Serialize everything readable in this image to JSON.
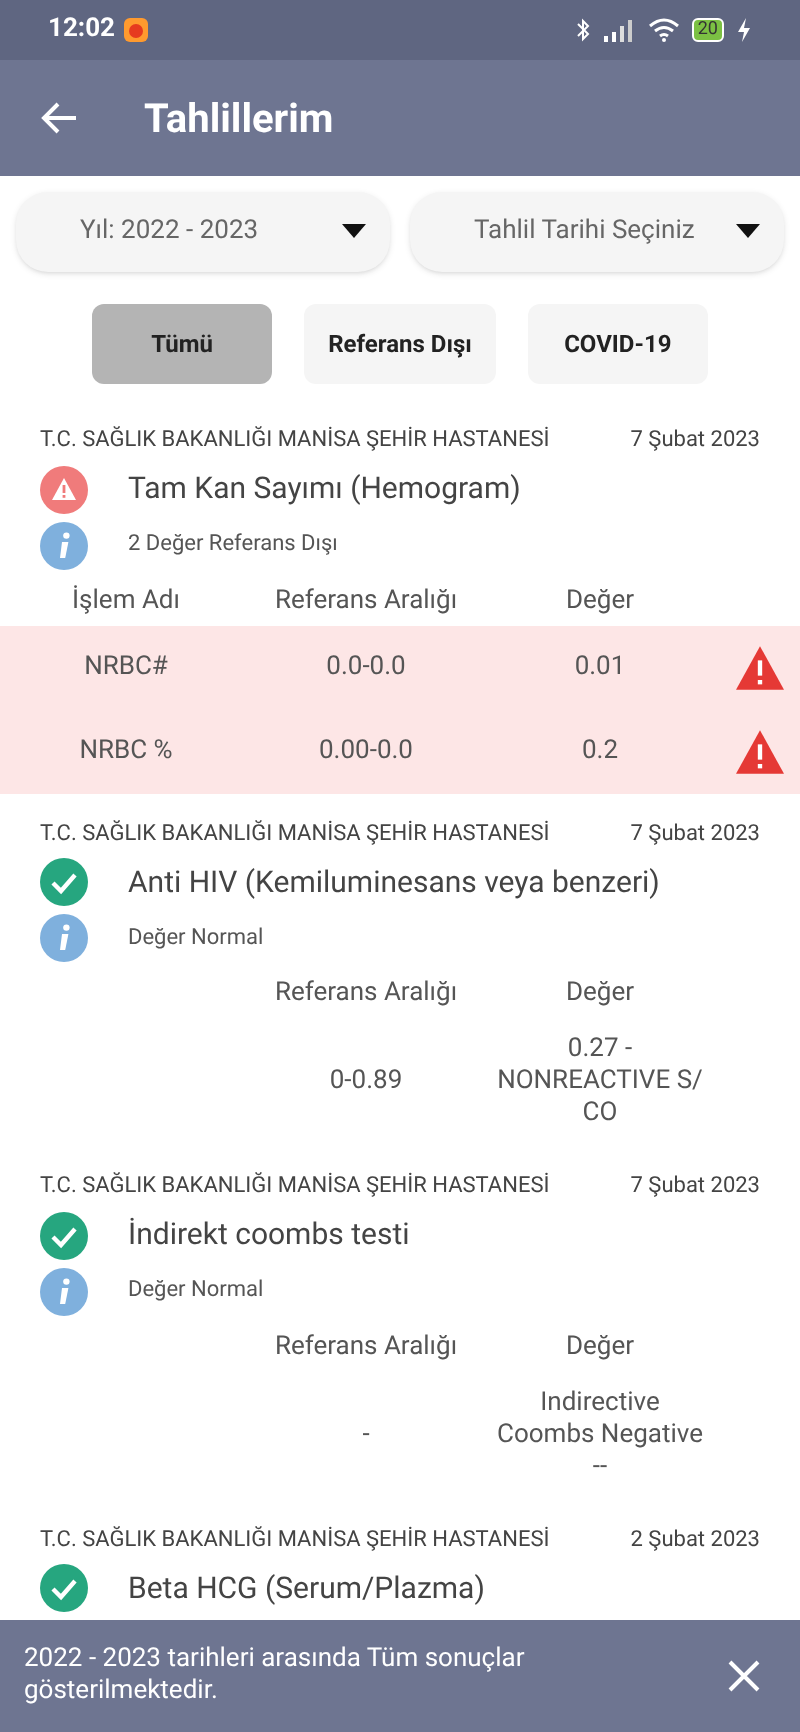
{
  "status_bar": {
    "time": "12:02",
    "battery": "20"
  },
  "header": {
    "title": "Tahlillerim"
  },
  "filters": [
    {
      "value": "Yıl: 2022 - 2023"
    },
    {
      "value": "Tahlil Tarihi Seçiniz"
    }
  ],
  "chips": [
    {
      "label": "Tümü",
      "selected": true
    },
    {
      "label": "Referans Dışı",
      "selected": false
    },
    {
      "label": "COVID-19",
      "selected": false
    }
  ],
  "results": [
    {
      "hospital": "T.C. SAĞLIK BAKANLIĞI MANİSA ŞEHİR HASTANESİ",
      "date": "7 Şubat 2023",
      "title": "Tam Kan Sayımı (Hemogram)",
      "abnormal": true,
      "summary": "2 Değer Referans Dışı",
      "columns": [
        "İşlem Adı",
        "Referans Aralığı",
        "Değer"
      ],
      "rows": [
        {
          "name": "NRBC#",
          "range": "0.0-0.0",
          "value": "0.01",
          "abnormal": true
        },
        {
          "name": "NRBC %",
          "range": "0.00-0.0",
          "value": "0.2",
          "abnormal": true
        }
      ]
    },
    {
      "hospital": "T.C. SAĞLIK BAKANLIĞI MANİSA ŞEHİR HASTANESİ",
      "date": "7 Şubat 2023",
      "title": "Anti HIV (Kemiluminesans veya benzeri)",
      "abnormal": false,
      "summary": "Değer Normal",
      "columns": [
        "",
        "Referans Aralığı",
        "Değer"
      ],
      "rows": [
        {
          "name": "",
          "range": "0-0.89",
          "value": "0.27 - NONREACTIVE S/ CO",
          "abnormal": false
        }
      ]
    },
    {
      "hospital": "T.C. SAĞLIK BAKANLIĞI MANİSA ŞEHİR HASTANESİ",
      "date": "7 Şubat 2023",
      "title": "İndirekt coombs testi",
      "abnormal": false,
      "summary": "Değer Normal",
      "columns": [
        "",
        "Referans Aralığı",
        "Değer"
      ],
      "rows": [
        {
          "name": "",
          "range": "-",
          "value": "Indirective Coombs Negative --",
          "abnormal": false
        }
      ]
    },
    {
      "hospital": "T.C. SAĞLIK BAKANLIĞI MANİSA ŞEHİR HASTANESİ",
      "date": "2 Şubat 2023",
      "title": "Beta HCG (Serum/Plazma)",
      "abnormal": false
    }
  ],
  "snackbar": {
    "message": "2022 - 2023 tarihleri arasında Tüm sonuçlar gösterilmektedir."
  }
}
